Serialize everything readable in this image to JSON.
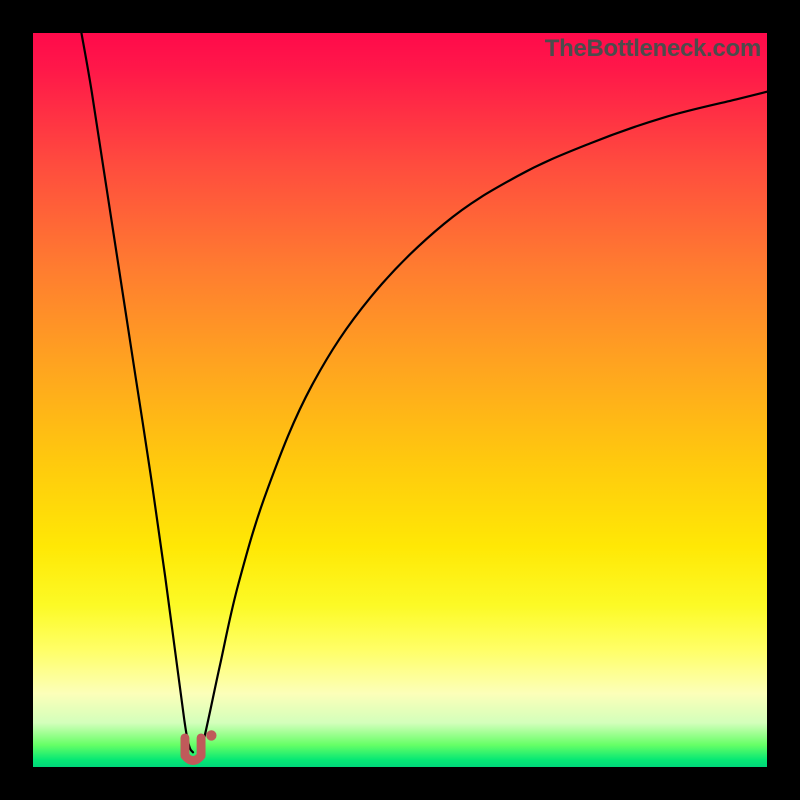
{
  "attribution": "TheBottleneck.com",
  "colors": {
    "frame": "#000000",
    "marker": "#c05a5a"
  },
  "chart_data": {
    "type": "line",
    "title": "",
    "xlabel": "",
    "ylabel": "",
    "xlim": [
      0,
      100
    ],
    "ylim": [
      0,
      100
    ],
    "grid": false,
    "legend": false,
    "series": [
      {
        "name": "curve-left",
        "x": [
          6.6,
          8.0,
          10.0,
          12.0,
          14.0,
          16.0,
          18.0,
          19.2,
          20.0,
          20.6,
          21.0,
          21.4,
          21.8
        ],
        "y": [
          100,
          92.0,
          79.0,
          66.0,
          53.0,
          40.0,
          26.0,
          17.0,
          11.0,
          6.5,
          4.0,
          2.5,
          2.0
        ]
      },
      {
        "name": "curve-right",
        "x": [
          22.6,
          23.2,
          24.0,
          25.5,
          28.0,
          32.0,
          38.0,
          46.0,
          56.0,
          66.0,
          76.0,
          86.0,
          96.0,
          100.0
        ],
        "y": [
          2.0,
          3.5,
          7.0,
          14.0,
          25.0,
          38.0,
          52.0,
          64.0,
          74.0,
          80.5,
          85.0,
          88.5,
          91.0,
          92.0
        ]
      }
    ],
    "markers": [
      {
        "shape": "U",
        "x": 21.8,
        "y": 2.2,
        "size": 2.2
      },
      {
        "shape": "dot",
        "x": 24.3,
        "y": 4.3,
        "r": 0.7
      }
    ]
  }
}
